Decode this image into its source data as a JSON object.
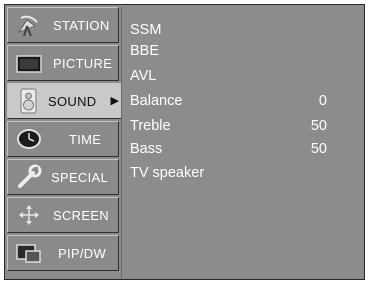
{
  "menu": {
    "items": [
      {
        "label": "STATION",
        "icon": "satellite-dish-icon",
        "selected": false
      },
      {
        "label": "PICTURE",
        "icon": "tv-screen-icon",
        "selected": false
      },
      {
        "label": "SOUND",
        "icon": "speaker-icon",
        "selected": true,
        "arrow": "▶"
      },
      {
        "label": "TIME",
        "icon": "clock-icon",
        "selected": false
      },
      {
        "label": "SPECIAL",
        "icon": "wrench-icon",
        "selected": false
      },
      {
        "label": "SCREEN",
        "icon": "move-arrows-icon",
        "selected": false
      },
      {
        "label": "PIP/DW",
        "icon": "pip-windows-icon",
        "selected": false
      }
    ]
  },
  "sound_menu": {
    "items": [
      {
        "label": "SSM",
        "value": ""
      },
      {
        "label": "BBE",
        "value": ""
      },
      {
        "label": "AVL",
        "value": ""
      },
      {
        "label": "Balance",
        "value": "0"
      },
      {
        "label": "Treble",
        "value": "50"
      },
      {
        "label": "Bass",
        "value": "50"
      },
      {
        "label": "TV speaker",
        "value": ""
      }
    ]
  },
  "colors": {
    "background": "#8c8c8c",
    "selected_item": "#c9c9c9",
    "text": "#ffffff"
  }
}
